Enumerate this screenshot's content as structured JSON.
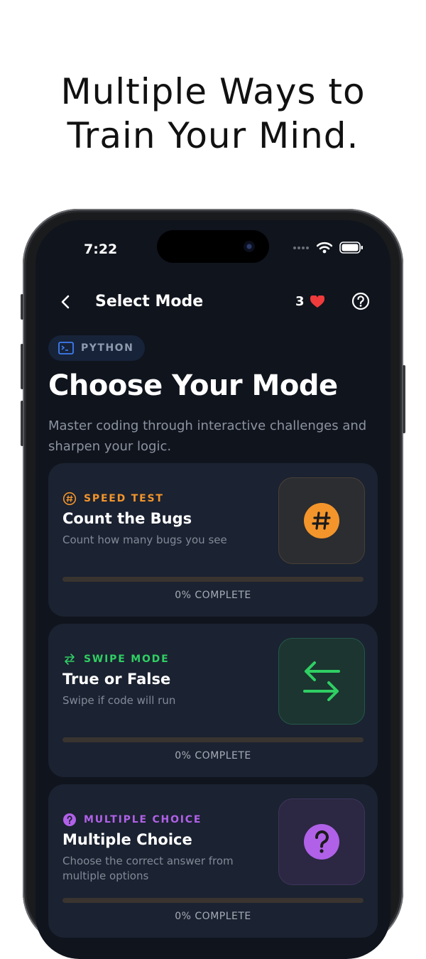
{
  "headline": {
    "line1": "Multiple Ways to",
    "line2": "Train Your Mind."
  },
  "status_bar": {
    "time": "7:22",
    "icons": [
      "signal-dots-icon",
      "wifi-icon",
      "battery-icon"
    ]
  },
  "nav": {
    "title": "Select Mode",
    "hearts_count": "3",
    "back_icon": "chevron-left-icon",
    "help_icon": "help-circle-icon"
  },
  "language_badge": {
    "label": "PYTHON",
    "icon": "terminal-icon"
  },
  "page": {
    "title": "Choose Your Mode",
    "subtitle": "Master coding through interactive challenges and sharpen your logic."
  },
  "modes": [
    {
      "tag": "SPEED TEST",
      "title": "Count the Bugs",
      "description": "Count how many bugs you see",
      "progress": 0,
      "progress_label": "0% COMPLETE",
      "accent": "#f3952b",
      "icon": "hash-icon"
    },
    {
      "tag": "SWIPE MODE",
      "title": "True or False",
      "description": "Swipe if code will run",
      "progress": 0,
      "progress_label": "0% COMPLETE",
      "accent": "#2fcf63",
      "icon": "swap-arrows-icon"
    },
    {
      "tag": "MULTIPLE CHOICE",
      "title": "Multiple Choice",
      "description": "Choose the correct answer from multiple options",
      "progress": 0,
      "progress_label": "0% COMPLETE",
      "accent": "#b061e8",
      "icon": "question-icon"
    }
  ],
  "colors": {
    "background": "#10141d",
    "card": "#1b2231",
    "heart": "#ef3b3b"
  }
}
